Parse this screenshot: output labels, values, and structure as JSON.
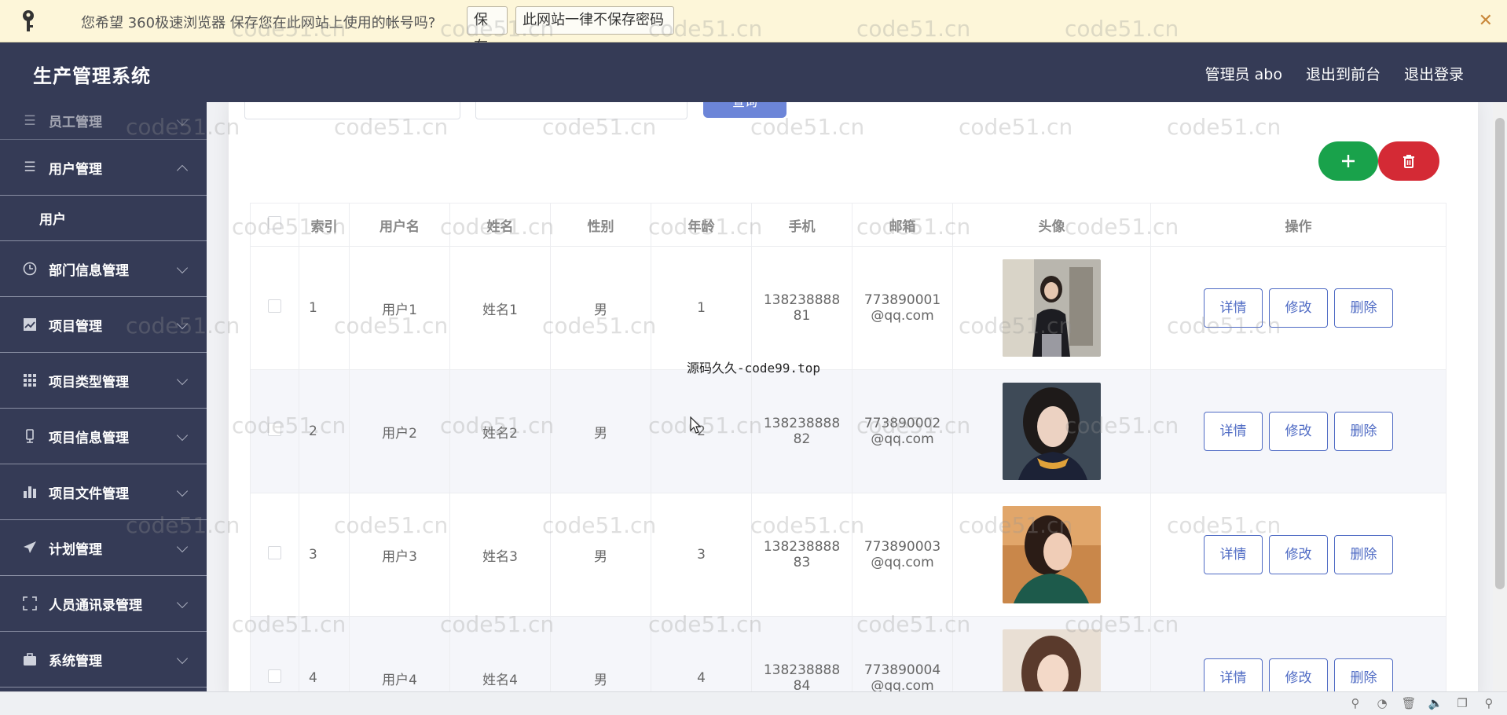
{
  "password_bar": {
    "message": "您希望 360极速浏览器 保存您在此网站上使用的帐号吗?",
    "save_label": "保存",
    "never_label": "此网站一律不保存密码",
    "close_label": "✕"
  },
  "header": {
    "title": "生产管理系统",
    "admin_label": "管理员 abo",
    "front_label": "退出到前台",
    "logout_label": "退出登录"
  },
  "sidebar": {
    "items": [
      {
        "label": "员工管理",
        "icon": "menu-icon"
      },
      {
        "label": "用户管理",
        "icon": "menu-icon"
      },
      {
        "label": "用户",
        "icon": ""
      },
      {
        "label": "部门信息管理",
        "icon": "clock-icon"
      },
      {
        "label": "项目管理",
        "icon": "chart-icon"
      },
      {
        "label": "项目类型管理",
        "icon": "grid-icon"
      },
      {
        "label": "项目信息管理",
        "icon": "device-icon"
      },
      {
        "label": "项目文件管理",
        "icon": "bar-icon"
      },
      {
        "label": "计划管理",
        "icon": "send-icon"
      },
      {
        "label": "人员通讯录管理",
        "icon": "fullscreen-icon"
      },
      {
        "label": "系统管理",
        "icon": "briefcase-icon"
      }
    ]
  },
  "search": {
    "query_button": "查询"
  },
  "table": {
    "headers": [
      "索引",
      "用户名",
      "姓名",
      "性别",
      "年龄",
      "手机",
      "邮箱",
      "头像",
      "操作"
    ],
    "rows": [
      {
        "index": "1",
        "username": "用户1",
        "name": "姓名1",
        "gender": "男",
        "age": "1",
        "phone_a": "138238888",
        "phone_b": "81",
        "email_a": "773890001",
        "email_b": "@qq.com"
      },
      {
        "index": "2",
        "username": "用户2",
        "name": "姓名2",
        "gender": "男",
        "age": "2",
        "phone_a": "138238888",
        "phone_b": "82",
        "email_a": "773890002",
        "email_b": "@qq.com"
      },
      {
        "index": "3",
        "username": "用户3",
        "name": "姓名3",
        "gender": "男",
        "age": "3",
        "phone_a": "138238888",
        "phone_b": "83",
        "email_a": "773890003",
        "email_b": "@qq.com"
      },
      {
        "index": "4",
        "username": "用户4",
        "name": "姓名4",
        "gender": "男",
        "age": "4",
        "phone_a": "138238888",
        "phone_b": "84",
        "email_a": "773890004",
        "email_b": "@qq.com"
      }
    ],
    "actions": {
      "detail": "详情",
      "edit": "修改",
      "delete": "删除"
    }
  },
  "watermark": {
    "text": "code51.cn"
  },
  "overlay": {
    "text": "源码久久-code99.top"
  },
  "colors": {
    "header_bg": "#353b56",
    "add_button": "#19a24b",
    "delete_button": "#d42a35",
    "action_border": "#4f6bc4"
  }
}
